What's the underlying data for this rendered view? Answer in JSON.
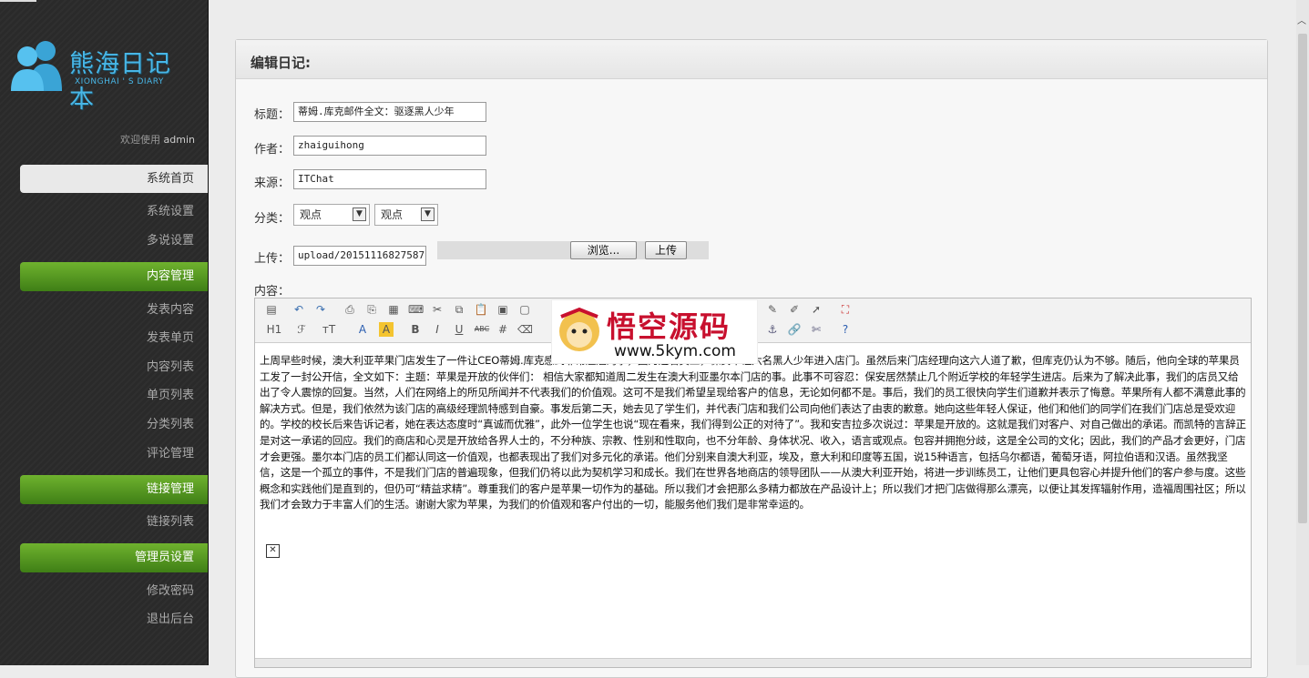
{
  "sidebar": {
    "brand_cn": "熊海日记本",
    "brand_en": "XIONGHAI ' S DIARY",
    "welcome_prefix": "欢迎使用",
    "welcome_user": "admin",
    "home": "系统首页",
    "settings_items": [
      "系统设置",
      "多说设置"
    ],
    "content_header": "内容管理",
    "content_items": [
      "发表内容",
      "发表单页",
      "内容列表",
      "单页列表",
      "分类列表",
      "评论管理"
    ],
    "links_header": "链接管理",
    "links_items": [
      "链接列表"
    ],
    "admin_header": "管理员设置",
    "admin_items": [
      "修改密码",
      "退出后台"
    ]
  },
  "form": {
    "panel_title": "编辑日记:",
    "title_label": "标题：",
    "title_value": "蒂姆.库克邮件全文：驱逐黑人少年",
    "author_label": "作者：",
    "author_value": "zhaiguihong",
    "source_label": "来源：",
    "source_value": "ITChat",
    "category_label": "分类：",
    "category_1": "观点",
    "category_2": "观点",
    "upload_label": "上传：",
    "upload_value": "upload/20151116827587",
    "browse_button": "浏览...",
    "upload_button": "上传",
    "content_label": "内容："
  },
  "editor": {
    "body": "上周早些时候，澳大利亚苹果门店发生了一件让CEO蒂姆.库克感到非常尴尬的事，因为这名员工，保安不让六名黑人少年进入店门。虽然后来门店经理向这六人道了歉，但库克仍认为不够。随后，他向全球的苹果员工发了一封公开信，全文如下：主题：苹果是开放的伙伴们： 相信大家都知道周二发生在澳大利亚墨尔本门店的事。此事不可容忍：保安居然禁止几个附近学校的年轻学生进店。后来为了解决此事，我们的店员又给出了令人震惊的回复。当然，人们在网络上的所见所闻并不代表我们的价值观。这可不是我们希望呈现给客户的信息，无论如何都不是。事后，我们的员工很快向学生们道歉并表示了悔意。苹果所有人都不满意此事的解决方式。但是，我们依然为该门店的高级经理凯特感到自豪。事发后第二天，她去见了学生们，并代表门店和我们公司向他们表达了由衷的歉意。她向这些年轻人保证，他们和他们的同学们在我们门店总是受欢迎的。学校的校长后来告诉记者，她在表达态度时“真诚而优雅”，此外一位学生也说“现在看来，我们得到公正的对待了”。我和安吉拉多次说过：苹果是开放的。这就是我们对客户、对自己做出的承诺。而凯特的言辞正是对这一承诺的回应。我们的商店和心灵是开放给各界人士的，不分种族、宗教、性别和性取向，也不分年龄、身体状况、收入，语言或观点。包容并拥抱分歧，这是全公司的文化；因此，我们的产品才会更好，门店才会更强。墨尔本门店的员工们都认同这一价值观，也都表现出了我们对多元化的承诺。他们分别来自澳大利亚，埃及，意大利和印度等五国，说15种语言，包括乌尔都语，葡萄牙语，阿拉伯语和汉语。虽然我坚信，这是一个孤立的事件，不是我们门店的普遍现象，但我们仍将以此为契机学习和成长。我们在世界各地商店的领导团队——从澳大利亚开始，将进一步训练员工，让他们更具包容心并提升他们的客户参与度。这些概念和实践他们是直到的，但仍可“精益求精”。尊重我们的客户是苹果一切作为的基础。所以我们才会把那么多精力都放在产品设计上；所以我们才把门店做得那么漂亮，以便让其发挥辐射作用，造福周围社区；所以我们才会致力于丰富人们的生活。谢谢大家为苹果，为我们的价值观和客户付出的一切，能服务他们我们是非常幸运的。",
    "toolbar_row2": [
      "H1",
      "ℱ",
      "тT",
      "A",
      "A",
      "B",
      "I",
      "U",
      "ABC"
    ]
  },
  "watermark": {
    "text_cn": "悟空源码",
    "url": "www.5kym.com"
  }
}
